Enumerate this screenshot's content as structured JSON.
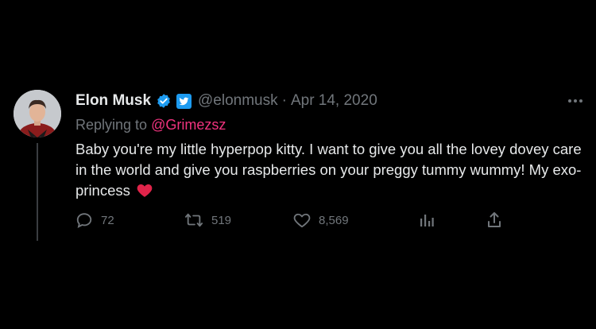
{
  "tweet": {
    "author": {
      "name": "Elon Musk",
      "handle": "@elonmusk",
      "verified": true,
      "avatar": "profile-photo-man-in-red-jacket"
    },
    "separator": "·",
    "date": "Apr 14, 2020",
    "replying_label": "Replying to",
    "replying_to": "@Grimezsz",
    "text": "Baby you're my little hyperpop kitty. I want to give you all the lovey dovey care in the world and give you raspberries on your preggy tummy wummy! My exo-princess",
    "emoji": "red-heart",
    "actions": {
      "reply_count": "72",
      "retweet_count": "519",
      "like_count": "8,569"
    }
  },
  "colors": {
    "background": "#000000",
    "primary_text": "#e7e9ea",
    "secondary_text": "#71767b",
    "mention": "#f0337e",
    "verified_blue": "#1d9bf0",
    "heart_red": "#e0244a"
  }
}
